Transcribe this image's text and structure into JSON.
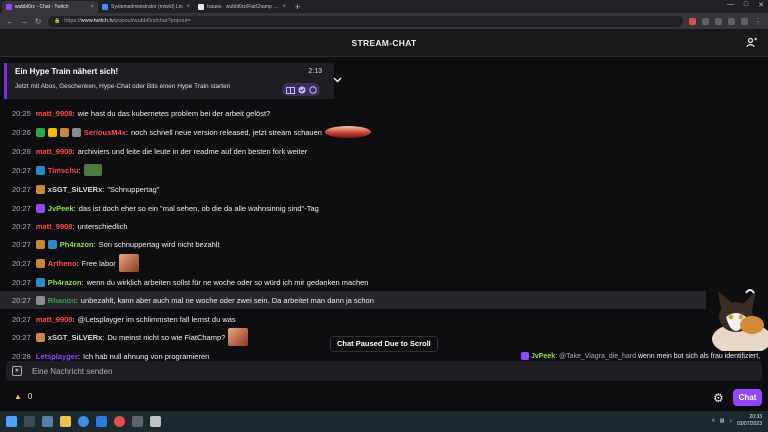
{
  "browser": {
    "tabs": [
      {
        "label": "wubbl0rz - Chat - Twitch",
        "fav_color": "#9147ff",
        "active": true
      },
      {
        "label": "Systemadministrator (m/w/d) Lin",
        "fav_color": "#4c8bf5",
        "active": false
      },
      {
        "label": "Issues · wubbl0rz/FiatChamp · Gi",
        "fav_color": "#e8eaed",
        "active": false
      }
    ],
    "new_tab": "+",
    "url_prefix": "https://",
    "url_domain": "www.twitch.tv",
    "url_path": "/popout/wubbl0rz/chat?popout="
  },
  "header": {
    "title": "STREAM-CHAT"
  },
  "hype_train": {
    "title": "Ein Hype Train nähert sich!",
    "subtitle": "Jetzt mit Abos, Geschenken, Hype-Chat oder Bits einen Hype Train starten",
    "timer": "2:13"
  },
  "messages": [
    {
      "time": "20:25",
      "badges": [],
      "user": "matt_9908",
      "color": "#ff4a4a",
      "text": "wie hast du das kubernetes problem bei der arbeit gelöst?",
      "emote": null
    },
    {
      "time": "20:26",
      "badges": [
        "#2da44e",
        "#f5b700",
        "#c8873a",
        "#8a8a92"
      ],
      "user": "SeriousM4x",
      "color": "#ff4a4a",
      "text": "noch schnell neue version released, jetzt stream schauen",
      "emote": "ship"
    },
    {
      "time": "20:26",
      "badges": [],
      "user": "matt_9908",
      "color": "#ff4a4a",
      "text": "archiviers und leite die leute in der readme auf den besten fork weiter",
      "emote": null
    },
    {
      "time": "20:27",
      "badges": [
        "#2e8bc0"
      ],
      "user": "Timschu",
      "color": "#ff4a4a",
      "text": "",
      "emote": "frog"
    },
    {
      "time": "20:27",
      "badges": [
        "#c8873a"
      ],
      "user": "xSGT_SiLVERx",
      "color": "#d9d9d9",
      "text": "\"Schnuppertag\"",
      "emote": null
    },
    {
      "time": "20:27",
      "badges": [
        "#9147ff"
      ],
      "user": "JvPeek",
      "color": "#8ee04a",
      "text": "das ist doch eher so ein \"mal sehen, ob die da alle wahnsinnig sind\"-Tag",
      "emote": null
    },
    {
      "time": "20:27",
      "badges": [],
      "user": "matt_9908",
      "color": "#ff4a4a",
      "text": "unterschiedlich",
      "emote": null
    },
    {
      "time": "20:27",
      "badges": [
        "#c8873a",
        "#2e8bc0"
      ],
      "user": "Ph4razon",
      "color": "#8ee04a",
      "text": "Son schnuppertag wird nicht bezahlt",
      "emote": null
    },
    {
      "time": "20:27",
      "badges": [
        "#c8873a"
      ],
      "user": "Artheno",
      "color": "#ff4a4a",
      "text": "Free labor",
      "emote": "face"
    },
    {
      "time": "20:27",
      "badges": [
        "#2e8bc0"
      ],
      "user": "Ph4razon",
      "color": "#8ee04a",
      "text": "wenn du wirklich arbeiten sollst für ne woche oder so würd ich mir gedanken machen",
      "emote": null
    },
    {
      "time": "20:27",
      "badges": [
        "#8a8a92"
      ],
      "user": "Rhanon",
      "color": "#2da44e",
      "text": "unbezahlt, kann aber auch mal ne woche oder zwei sein. Da arbeitet man dann ja schon",
      "emote": null
    },
    {
      "time": "20:27",
      "badges": [],
      "user": "matt_9908",
      "color": "#ff4a4a",
      "text": "@Letsplayger im schlimmsten fall lernst du was",
      "emote": null
    },
    {
      "time": "20:27",
      "badges": [
        "#c8873a"
      ],
      "user": "xSGT_SiLVERx",
      "color": "#d9d9d9",
      "text": "Du meinst nicht so wie FiatChamp?",
      "emote": "face"
    },
    {
      "time": "20:28",
      "badges": [],
      "user": "Letsplayger",
      "color": "#9147ff",
      "text": "Ich hab null ahnung von programieren",
      "emote": null
    }
  ],
  "paused_banner": "Chat Paused Due to Scroll",
  "input": {
    "placeholder": "Eine Nachricht senden"
  },
  "channel_points": "0",
  "send_label": "Chat",
  "overlay_chat": {
    "user": "JvPeek",
    "mention": "@Take_Viagra_die_hard",
    "text": "wenn mein bot sich als frau identifiziert, ist das so"
  },
  "taskbar": {
    "time": "20:33",
    "date": "03/07/2023"
  }
}
